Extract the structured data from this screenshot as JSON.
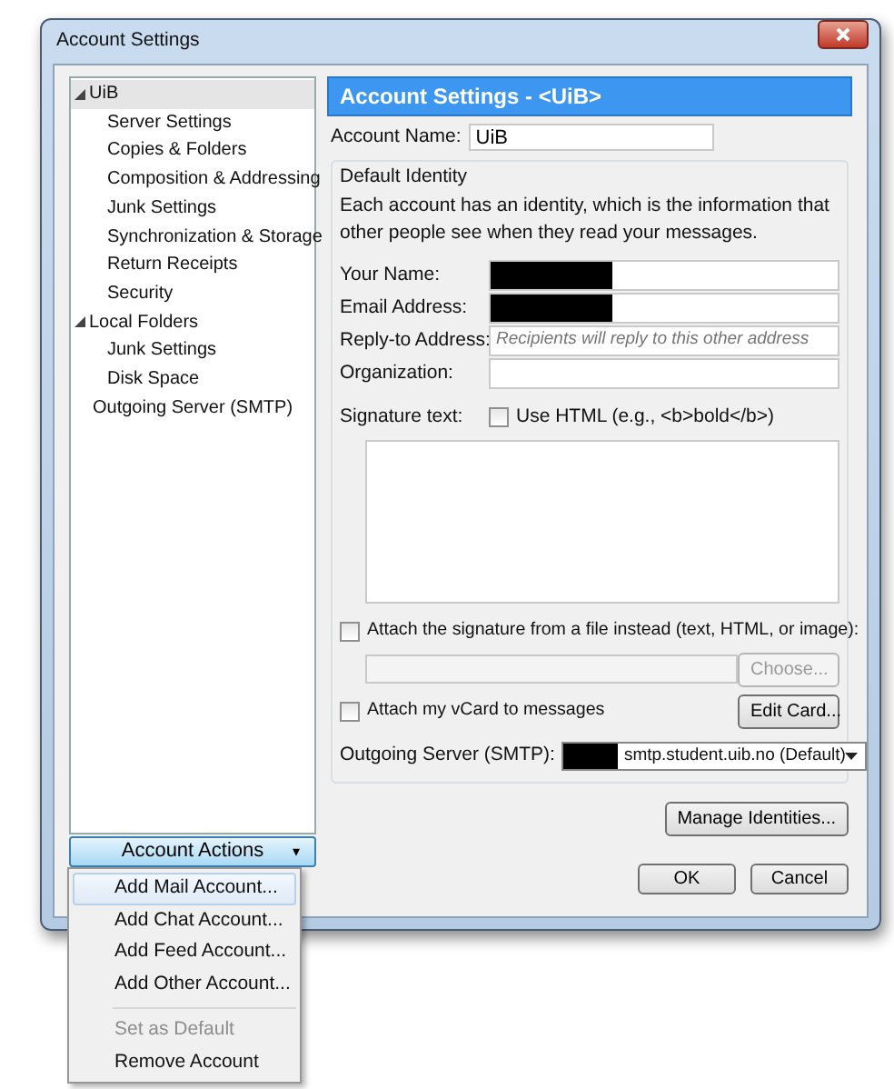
{
  "window": {
    "title": "Account Settings"
  },
  "sidebar": {
    "items": [
      {
        "label": "UiB",
        "selected": true,
        "expanded": true,
        "children": [
          {
            "label": "Server Settings",
            "selected": false
          },
          {
            "label": "Copies & Folders",
            "selected": false
          },
          {
            "label": "Composition & Addressing",
            "selected": false
          },
          {
            "label": "Junk Settings",
            "selected": false
          },
          {
            "label": "Synchronization & Storage",
            "selected": false
          },
          {
            "label": "Return Receipts",
            "selected": false
          },
          {
            "label": "Security",
            "selected": false
          }
        ]
      },
      {
        "label": "Local Folders",
        "selected": false,
        "expanded": true,
        "children": [
          {
            "label": "Junk Settings",
            "selected": false
          },
          {
            "label": "Disk Space",
            "selected": false
          }
        ]
      },
      {
        "label": "Outgoing Server (SMTP)",
        "selected": false
      }
    ]
  },
  "account_actions": {
    "label": "Account Actions",
    "caret": "▾",
    "expanded": true,
    "menu": [
      {
        "label": "Add Mail Account...",
        "disabled": false,
        "selected": true,
        "separator_before": false
      },
      {
        "label": "Add Chat Account...",
        "disabled": false,
        "selected": false,
        "separator_before": false
      },
      {
        "label": "Add Feed Account...",
        "disabled": false,
        "selected": false,
        "separator_before": false
      },
      {
        "label": "Add Other Account...",
        "disabled": false,
        "selected": false,
        "separator_before": false
      },
      {
        "label": "Set as Default",
        "disabled": true,
        "selected": false,
        "separator_before": true
      },
      {
        "label": "Remove Account",
        "disabled": false,
        "selected": false,
        "separator_before": false
      }
    ]
  },
  "header": {
    "title": "Account Settings - <UiB>"
  },
  "account_name": {
    "label": "Account Name:",
    "value": "UiB"
  },
  "identity": {
    "title": "Default Identity",
    "description": "Each account has an identity, which is the information that other people see when they read your messages.",
    "fields": [
      {
        "label": "Your Name:",
        "redacted": true
      },
      {
        "label": "Email Address:",
        "redacted": true
      },
      {
        "label": "Reply-to Address:",
        "placeholder": "Recipients will reply to this other address",
        "redacted": false
      },
      {
        "label": "Organization:",
        "redacted": false
      }
    ],
    "signature_label": "Signature text:",
    "use_html": {
      "label": "Use HTML (e.g., <b>bold</b>)",
      "checked": false
    },
    "attach_file": {
      "label": "Attach the signature from a file instead (text, HTML, or image):",
      "checked": false
    },
    "choose_button": {
      "label": "Choose...",
      "disabled": true
    },
    "vcard": {
      "label": "Attach my vCard to messages",
      "checked": false
    },
    "edit_card_button": {
      "label": "Edit Card...",
      "disabled": false
    },
    "outgoing_server": {
      "label": "Outgoing Server (SMTP):",
      "value": "smtp.student.uib.no (Default)",
      "redacted": true
    },
    "manage_button": {
      "label": "Manage Identities..."
    }
  },
  "buttons": [
    {
      "label": "OK"
    },
    {
      "label": "Cancel"
    }
  ]
}
